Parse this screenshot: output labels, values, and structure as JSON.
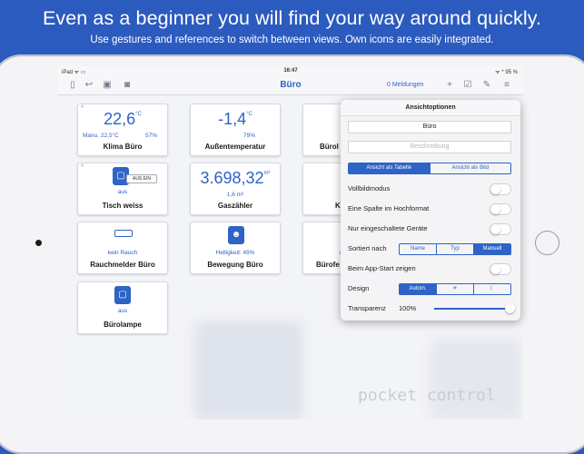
{
  "headline": "Even as a beginner you will find your way around quickly.",
  "subline": "Use gestures and references to switch between views. Own icons are easily integrated.",
  "status": {
    "left": "iPad ᯤ ▭",
    "time": "16:47",
    "right": "ᯤ * 95 %"
  },
  "navbar": {
    "title": "Büro",
    "messages": "0 Meldungen"
  },
  "tiles": {
    "klima": {
      "value": "22,6",
      "unit": "°C",
      "sub_left": "Manu. 22,5°C",
      "sub_right": "57%",
      "name": "Klima Büro"
    },
    "aussen": {
      "value": "-1,4",
      "unit": "°C",
      "sub": "79%",
      "name": "Außentemperatur"
    },
    "buero_partial": {
      "name": "Bürol"
    },
    "tisch": {
      "switch": "AUS EIN",
      "state": "aus",
      "name": "Tisch weiss"
    },
    "gas": {
      "value": "3.698,32",
      "unit": "m³",
      "sub": "1,6 m³",
      "name": "Gaszähler"
    },
    "k_partial": {
      "name": "K"
    },
    "rauch": {
      "state": "kein Rauch",
      "name": "Rauchmelder Büro"
    },
    "bewegung": {
      "state": "Helligkeit: 49%",
      "name": "Bewegung Büro"
    },
    "fenster_partial": {
      "state": "ges",
      "name": "Bürofe"
    },
    "lampe": {
      "state": "aus",
      "name": "Bürolampe"
    }
  },
  "popover": {
    "title": "Ansichtoptionen",
    "name_value": "Büro",
    "desc_placeholder": "Beschreibung",
    "view_seg": [
      "Ansicht als Tabelle",
      "Ansicht als Bild"
    ],
    "rows": {
      "vollbild": "Vollbildmodus",
      "spalte": "Eine Spalte im Hochformat",
      "eingeschaltet": "Nur eingeschaltete Geräte",
      "sortiert": "Sortiert nach",
      "appstart": "Beim App-Start zeigen",
      "design": "Design",
      "transparenz": "Transparenz",
      "transparenz_value": "100%"
    },
    "sort_seg": [
      "Name",
      "Typ",
      "Manuell"
    ],
    "design_seg": [
      "Autom.",
      "☀",
      "☾"
    ],
    "transparency_level": 1.0
  },
  "watermark": "pocket control"
}
